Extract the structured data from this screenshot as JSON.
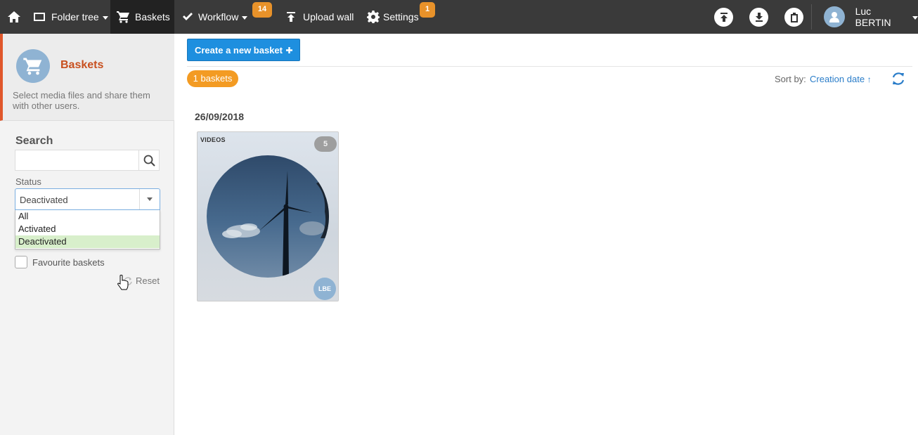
{
  "topnav": {
    "items": [
      {
        "label": "Folder tree"
      },
      {
        "label": "Baskets"
      },
      {
        "label": "Workflow",
        "badge": "14"
      },
      {
        "label": "Upload wall"
      },
      {
        "label": "Settings",
        "badge": "1"
      }
    ],
    "user_name": "Luc BERTIN"
  },
  "sidebar": {
    "title": "Baskets",
    "description": "Select media files and share them with other users.",
    "search_title": "Search",
    "search_placeholder": "",
    "status_label": "Status",
    "status_value": "Deactivated",
    "status_options": [
      "All",
      "Activated",
      "Deactivated"
    ],
    "favourite_label": "Favourite baskets",
    "reset_label": "Reset"
  },
  "main": {
    "create_button": "Create a new basket",
    "count_label": "1 baskets",
    "sort_label": "Sort by:",
    "sort_value": "Creation date",
    "groups": [
      {
        "date": "26/09/2018",
        "cards": [
          {
            "label": "VIDEOS",
            "count": "5",
            "owner": "LBE"
          }
        ]
      }
    ]
  },
  "colors": {
    "topbar": "#3a3a3a",
    "accent_blue": "#1e8fdf",
    "accent_orange": "#f39b23",
    "brand_red": "#c8501f",
    "selected_option": "#d8efcb"
  },
  "icons": [
    "home-icon",
    "folder-icon",
    "cart-icon",
    "check-icon",
    "upload-icon",
    "gear-icon",
    "upload-circle-icon",
    "download-circle-icon",
    "clipboard-icon",
    "user-avatar-icon",
    "search-icon",
    "refresh-icon",
    "plus-icon",
    "pointer-cursor-icon"
  ]
}
